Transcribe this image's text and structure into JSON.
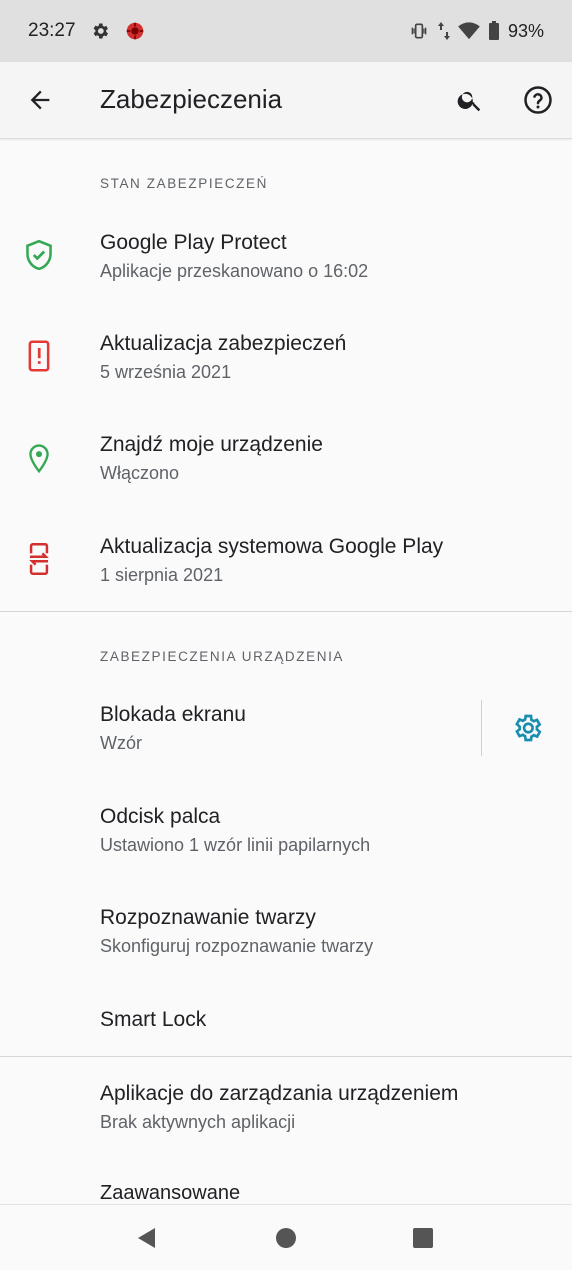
{
  "status_bar": {
    "time": "23:27",
    "battery": "93%",
    "icons": [
      "gear-icon",
      "app-notification-icon",
      "vibrate-icon",
      "data-arrows-icon",
      "wifi-icon",
      "battery-icon"
    ]
  },
  "app_bar": {
    "title": "Zabezpieczenia",
    "icons": [
      "back-arrow-icon",
      "search-icon",
      "help-icon"
    ]
  },
  "security_status": {
    "header": "STAN ZABEZPIECZEŃ",
    "items": [
      {
        "title": "Google Play Protect",
        "subtitle": "Aplikacje przeskanowano o 16:02",
        "icon": "shield-check-icon",
        "icon_color": "#34a853"
      },
      {
        "title": "Aktualizacja zabezpieczeń",
        "subtitle": "5 września 2021",
        "icon": "phone-alert-icon",
        "icon_color": "#e53935"
      },
      {
        "title": "Znajdź moje urządzenie",
        "subtitle": "Włączono",
        "icon": "location-pin-icon",
        "icon_color": "#34a853"
      },
      {
        "title": "Aktualizacja systemowa Google Play",
        "subtitle": "1 sierpnia 2021",
        "icon": "system-update-icon",
        "icon_color": "#d32f2f"
      }
    ]
  },
  "device_security": {
    "header": "ZABEZPIECZENIA URZĄDZENIA",
    "items": [
      {
        "title": "Blokada ekranu",
        "subtitle": "Wzór",
        "action_icon": "gear-icon",
        "action_color": "#1a8db0"
      },
      {
        "title": "Odcisk palca",
        "subtitle": "Ustawiono 1 wzór linii papilarnych"
      },
      {
        "title": "Rozpoznawanie twarzy",
        "subtitle": "Skonfiguruj rozpoznawanie twarzy"
      },
      {
        "title": "Smart Lock",
        "subtitle": ""
      }
    ]
  },
  "more": {
    "items": [
      {
        "title": "Aplikacje do zarządzania urządzeniem",
        "subtitle": "Brak aktywnych aplikacji"
      },
      {
        "title": "Zaawansowane",
        "subtitle": ""
      }
    ]
  },
  "nav_bar": {
    "icons": [
      "back-triangle-icon",
      "home-circle-icon",
      "recents-square-icon"
    ]
  }
}
